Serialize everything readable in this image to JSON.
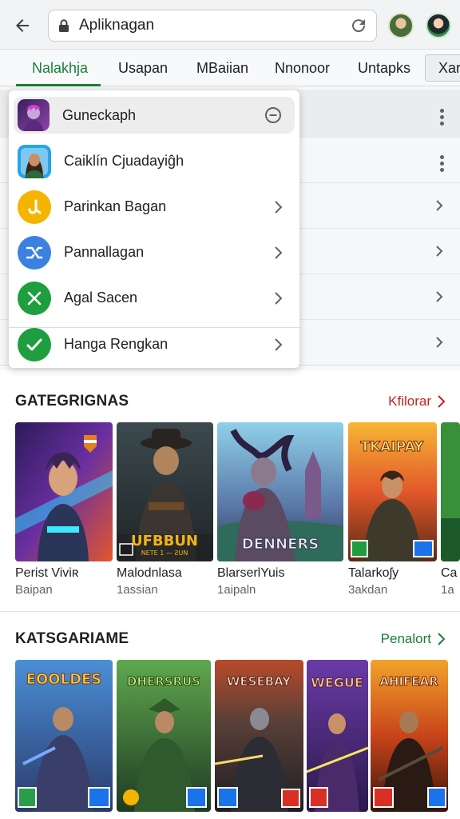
{
  "browser": {
    "url_text": "Apliknagan"
  },
  "tabs": [
    {
      "label": "Nalakhja",
      "active": true
    },
    {
      "label": "Usapan"
    },
    {
      "label": "MBaiian"
    },
    {
      "label": "Nnonoor"
    },
    {
      "label": "Untapks"
    },
    {
      "label": "Xar"
    }
  ],
  "dropdown": {
    "items": [
      {
        "label": "Guneckaph",
        "icon": "game-character-icon",
        "trailing": "minus-circle-icon"
      },
      {
        "label": "Caiklín Cjuadayiĝh",
        "icon": "avatar-woman-icon",
        "trailing": "none"
      },
      {
        "label": "Parinkan Bagan",
        "icon": "yellow-j-icon",
        "trailing": "chevron-right-icon"
      },
      {
        "label": "Pannallagan",
        "icon": "blue-shuffle-icon",
        "trailing": "chevron-right-icon"
      },
      {
        "label": "Agal Sacen",
        "icon": "green-x-icon",
        "trailing": "chevron-right-icon"
      },
      {
        "label": "Hanga Rengkan",
        "icon": "green-check-icon",
        "trailing": "chevron-right-icon"
      }
    ]
  },
  "section1": {
    "title": "GATEGRIGNAS",
    "link": "Kfilorar",
    "link_color": "#c5221f",
    "cards": [
      {
        "title": "Perist Viviʀ",
        "subtitle": "Baipan"
      },
      {
        "title": "Malodnlasa",
        "subtitle": "1assian",
        "banner": "UFBBUN",
        "banner_sub": "NETE 1 — ƧUN"
      },
      {
        "title": "BlarserlYuis",
        "subtitle": "1aipaln",
        "banner": "DENNERS"
      },
      {
        "title": "Talarkoʃy",
        "subtitle": "3akdan",
        "banner": "TKAIPAY"
      },
      {
        "title": "Ca",
        "subtitle": "1a"
      }
    ]
  },
  "section2": {
    "title": "KATSGARIAME",
    "link": "Penalort",
    "link_color": "#188038",
    "cards": [
      {
        "banner": "EOOLDES"
      },
      {
        "banner": "DHERSRUS"
      },
      {
        "banner": "WESEBAY"
      },
      {
        "banner": "WEGUE"
      },
      {
        "banner": "AHIFEAR"
      }
    ]
  },
  "colors": {
    "accent_green": "#188038",
    "link_red": "#c5221f"
  }
}
